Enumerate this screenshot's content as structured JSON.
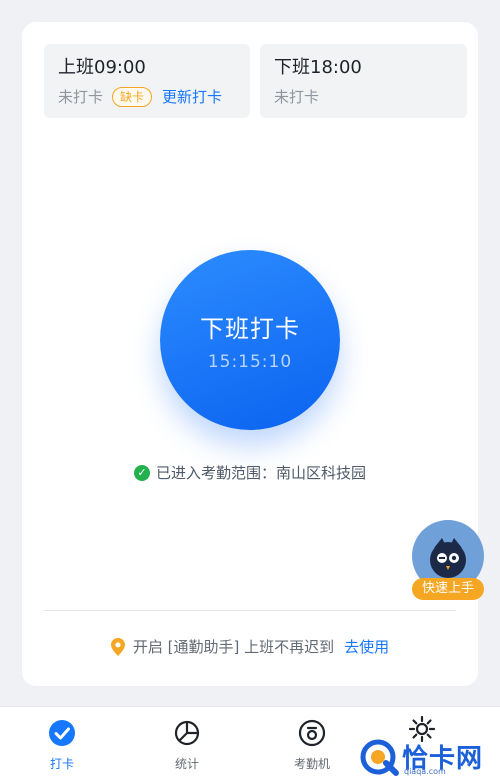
{
  "shifts": {
    "on": {
      "title": "上班09:00",
      "status": "未打卡",
      "badge": "缺卡",
      "action": "更新打卡"
    },
    "off": {
      "title": "下班18:00",
      "status": "未打卡"
    }
  },
  "clock_button": {
    "label": "下班打卡",
    "time": "15:15:10"
  },
  "location": {
    "text": "已进入考勤范围：南山区科技园"
  },
  "quick_start": {
    "label": "快速上手"
  },
  "assist": {
    "text": "开启 [通勤助手] 上班不再迟到",
    "link": "去使用"
  },
  "tabs": [
    {
      "label": "打卡",
      "icon": "check-circle-icon",
      "active": true
    },
    {
      "label": "统计",
      "icon": "pie-chart-icon",
      "active": false
    },
    {
      "label": "考勤机",
      "icon": "device-icon",
      "active": false
    }
  ],
  "watermark": {
    "text": "恰卡网",
    "sub": "qiaqa.com"
  },
  "colors": {
    "accent": "#1677ff",
    "warning": "#f5a623",
    "success": "#22b14c"
  }
}
